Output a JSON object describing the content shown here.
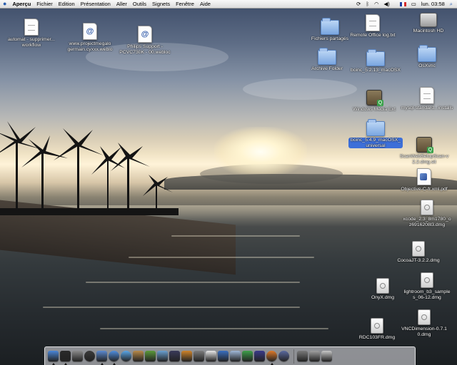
{
  "menubar": {
    "apple": "",
    "app_name": "Aperçu",
    "menus": [
      "Fichier",
      "Edition",
      "Présentation",
      "Aller",
      "Outils",
      "Signets",
      "Fenêtre",
      "Aide"
    ],
    "clock": "lun. 03:58"
  },
  "desktop_icons": [
    {
      "label": "automat - supprimer... workflow",
      "icon": "document-icon"
    },
    {
      "label": "www.projectmegalo germain.cyxxx.weblo",
      "icon": "webloc-icon"
    },
    {
      "label": "Philips Support - PCVC730K - 00.webloc",
      "icon": "webloc-icon"
    },
    {
      "label": "Fichiers partagés",
      "icon": "folder-icon"
    },
    {
      "label": "Remote Office log.txt",
      "icon": "document-icon"
    },
    {
      "label": "Macintosh HD",
      "icon": "hard-disk-icon"
    },
    {
      "label": "Archive Folder",
      "icon": "folder-icon"
    },
    {
      "label": "boinc_5.2.13_macOSX",
      "icon": "folder-icon"
    },
    {
      "label": "OsXvnc",
      "icon": "folder-icon"
    },
    {
      "label": "Windows Media Ext",
      "icon": "application-icon"
    },
    {
      "label": "mysql-standard...installs",
      "icon": "document-icon"
    },
    {
      "label": "boinc_5.4.9_macOSX_universal",
      "icon": "folder-icon"
    },
    {
      "label": "ScanWebSetupScan-v 2.2.dmg.sit",
      "icon": "application-icon"
    },
    {
      "label": "Objective-C-fr.xml.pdf",
      "icon": "pdf-icon"
    },
    {
      "label": "xcode_2.3_8m1780_o z6916208l3.dmg",
      "icon": "disk-image-icon"
    },
    {
      "label": "CocoaJT-3.2.2.dmg",
      "icon": "disk-image-icon"
    },
    {
      "label": "OnyX.dmg",
      "icon": "disk-image-icon"
    },
    {
      "label": "lightroom_b3_sample s_06-12.dmg",
      "icon": "disk-image-icon"
    },
    {
      "label": "RDC103FR.dmg",
      "icon": "disk-image-icon"
    },
    {
      "label": "VNCDimension-0.7.1 0.dmg",
      "icon": "disk-image-icon"
    }
  ],
  "dock_items": [
    {
      "name": "finder-icon",
      "color": "#4a86d8"
    },
    {
      "name": "terminal-icon",
      "color": "#2a2a2a"
    },
    {
      "name": "system-preferences-icon",
      "color": "#8a8a8a"
    },
    {
      "name": "dvd-player-icon",
      "color": "#3a3a3a"
    },
    {
      "name": "preview-icon",
      "color": "#5b89cf"
    },
    {
      "name": "safari-icon",
      "color": "#4f8fe0"
    },
    {
      "name": "ichat-icon",
      "color": "#5aa7e8"
    },
    {
      "name": "address-book-icon",
      "color": "#b88a4a"
    },
    {
      "name": "itunes-icon",
      "color": "#5c9a3a"
    },
    {
      "name": "iphoto-icon",
      "color": "#6aa0d0"
    },
    {
      "name": "imovie-icon",
      "color": "#3a3a5a"
    },
    {
      "name": "garageband-icon",
      "color": "#d0842a"
    },
    {
      "name": "istudio-icon",
      "color": "#7c7c7c"
    },
    {
      "name": "ical-icon",
      "color": "#e8e8e8"
    },
    {
      "name": "quicktime-icon",
      "color": "#3a6fc0"
    },
    {
      "name": "mail-icon",
      "color": "#a0b8d8"
    },
    {
      "name": "ichat-av-icon",
      "color": "#3fa04a"
    },
    {
      "name": "xcode-icon",
      "color": "#3a3a8a"
    },
    {
      "name": "firefox-icon",
      "color": "#e07a2a"
    },
    {
      "name": "boinc-icon",
      "color": "#5a6aa0"
    },
    {
      "name": "disk-utility-icon",
      "color": "#7a7a7a"
    },
    {
      "name": "network-icon",
      "color": "#a0a0a0"
    },
    {
      "name": "trash-icon",
      "color": "#c8c8c8"
    }
  ]
}
